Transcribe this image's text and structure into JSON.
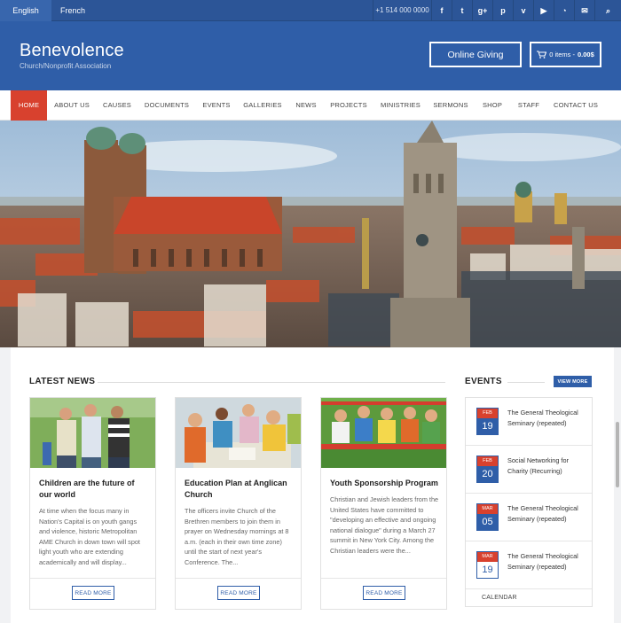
{
  "topbar": {
    "languages": [
      "English",
      "French"
    ],
    "phone": "+1 514 000 0000",
    "social_icons": [
      "facebook-icon",
      "twitter-icon",
      "google-plus-icon",
      "pinterest-icon",
      "vimeo-icon",
      "youtube-icon",
      "rss-icon",
      "mail-icon",
      "search-icon"
    ],
    "social_glyphs": [
      "f",
      "t",
      "g+",
      "p",
      "v",
      "▶",
      "◔",
      "✉",
      "⌕"
    ]
  },
  "header": {
    "brand": "Benevolence",
    "tagline": "Church/Nonprofit Association",
    "giving_label": "Online Giving",
    "cart_label": "0 items -",
    "cart_total": "0.00$"
  },
  "nav": {
    "items": [
      "Home",
      "About Us",
      "Causes",
      "Documents",
      "Events",
      "Galleries",
      "News",
      "Projects",
      "Ministries",
      "Sermons",
      "Shop",
      "Staff",
      "Contact Us"
    ],
    "active": "Home"
  },
  "news": {
    "heading": "LATEST NEWS",
    "cards": [
      {
        "title": "Children are the future of our world",
        "body": "At time when the focus many in Nation's Capital is on youth gangs and violence, historic Metropolitan AME Church in down town will spot light youth who are extending academically and will display...",
        "button": "READ MORE"
      },
      {
        "title": "Education Plan at Anglican Church",
        "body": "The officers invite Church of the Brethren members to join them in prayer on Wednesday mornings at 8 a.m. (each in their own time zone) until the start of next year's Conference. The...",
        "button": "READ MORE"
      },
      {
        "title": "Youth Sponsorship Program",
        "body": "Christian and Jewish leaders from the United States have committed to \"developing an effective and ongoing national dialogue\" during a March 27 summit in New York City. Among the Christian leaders were the...",
        "button": "READ MORE"
      }
    ]
  },
  "events": {
    "heading": "EVENTS",
    "view_more": "VIEW MORE",
    "items": [
      {
        "month": "FEB",
        "day": "19",
        "title": "The General Theological Seminary (repeated)"
      },
      {
        "month": "FEB",
        "day": "20",
        "title": "Social Networking for Charity (Recurring)"
      },
      {
        "month": "MAR",
        "day": "05",
        "title": "The General Theological Seminary (repeated)"
      },
      {
        "month": "MAR",
        "day": "19",
        "title": "The General Theological Seminary (repeated)"
      }
    ],
    "calendar_label": "CALENDAR"
  },
  "colors": {
    "primary_blue": "#2f5ea8",
    "topbar_blue": "#2c5597",
    "accent_red": "#d8412e"
  }
}
